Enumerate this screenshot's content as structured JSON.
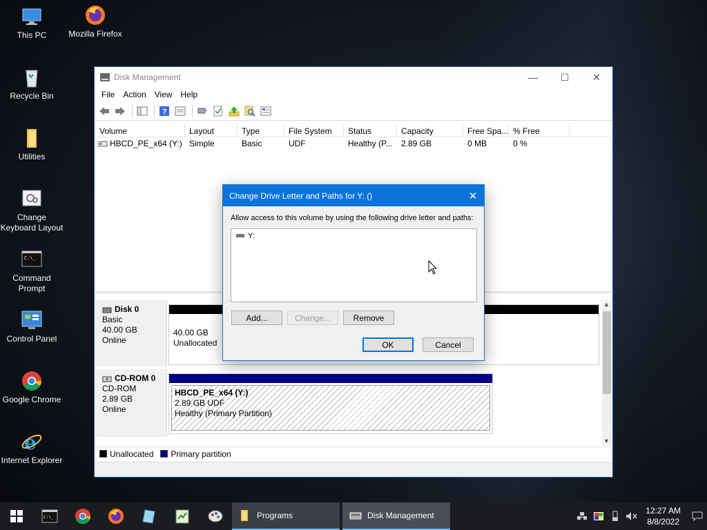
{
  "desktop": {
    "icons": [
      {
        "label": "This PC"
      },
      {
        "label": "Mozilla Firefox"
      },
      {
        "label": "Recycle Bin"
      },
      {
        "label": "Utilities"
      },
      {
        "label": "Change Keyboard Layout"
      },
      {
        "label": "Command Prompt"
      },
      {
        "label": "Control Panel"
      },
      {
        "label": "Google Chrome"
      },
      {
        "label": "Internet Explorer"
      }
    ]
  },
  "window": {
    "title": "Disk Management",
    "menu": [
      "File",
      "Action",
      "View",
      "Help"
    ],
    "columns": [
      "Volume",
      "Layout",
      "Type",
      "File System",
      "Status",
      "Capacity",
      "Free Spa...",
      "% Free"
    ],
    "rows": [
      [
        "HBCD_PE_x64 (Y:)",
        "Simple",
        "Basic",
        "UDF",
        "Healthy (P...",
        "2.89 GB",
        "0 MB",
        "0 %"
      ]
    ],
    "disks": [
      {
        "name": "Disk 0",
        "type": "Basic",
        "size": "40.00 GB",
        "state": "Online",
        "part_size": "40.00 GB",
        "part_label": "Unallocated"
      },
      {
        "name": "CD-ROM 0",
        "type": "CD-ROM",
        "size": "2.89 GB",
        "state": "Online",
        "part_name": "HBCD_PE_x64  (Y:)",
        "part_size": "2.89 GB UDF",
        "part_status": "Healthy (Primary Partition)"
      }
    ],
    "legend": [
      "Unallocated",
      "Primary partition"
    ]
  },
  "dialog": {
    "title": "Change Drive Letter and Paths for Y: ()",
    "description": "Allow access to this volume by using the following drive letter and paths:",
    "paths": [
      "Y:"
    ],
    "buttons": {
      "add": "Add...",
      "change": "Change...",
      "remove": "Remove",
      "ok": "OK",
      "cancel": "Cancel"
    }
  },
  "taskbar": {
    "programs_label": "Programs",
    "disk_mgmt_label": "Disk Management",
    "time": "12:27 AM",
    "date": "8/8/2022"
  },
  "colors": {
    "accent": "#0a74da",
    "unallocated": "#000000",
    "primary_partition": "#00008b"
  }
}
